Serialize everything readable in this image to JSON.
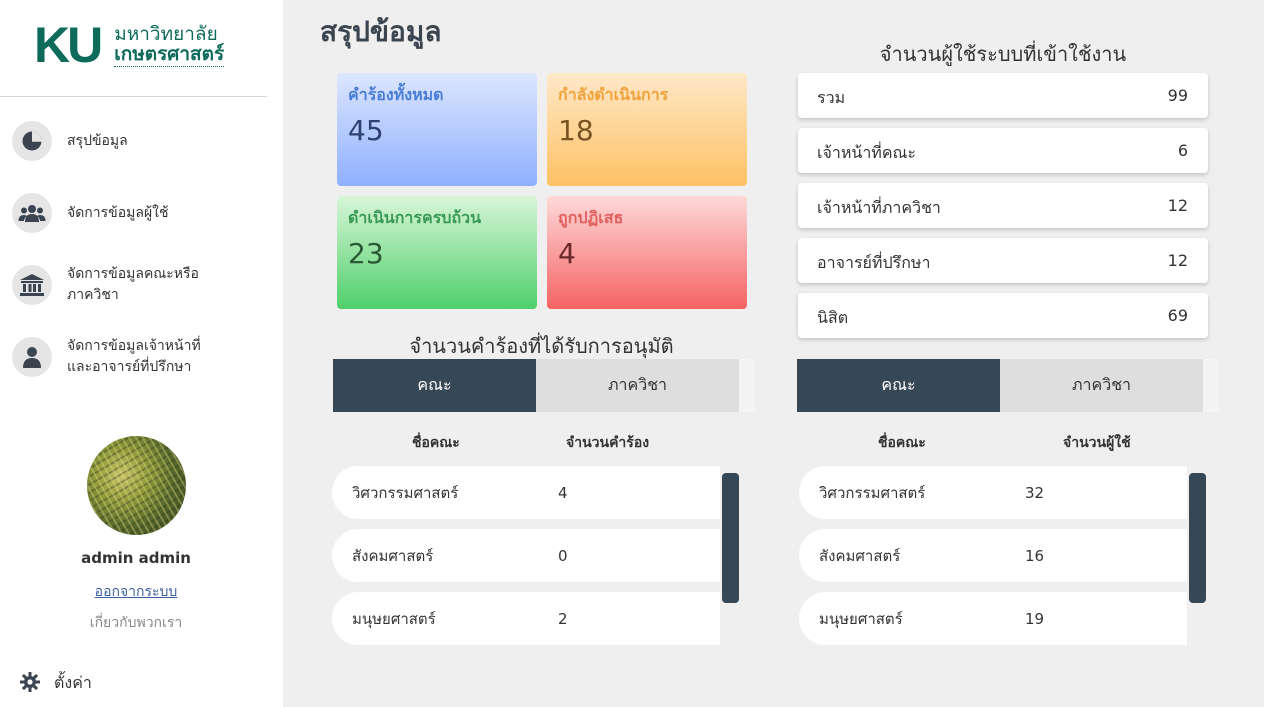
{
  "logo": {
    "mark": "KU",
    "line1": "มหาวิทยาลัย",
    "line2": "เกษตรศาสตร์"
  },
  "sidebar": {
    "items": [
      {
        "label": "สรุปข้อมูล",
        "icon": "pie-chart-icon"
      },
      {
        "label": "จัดการข้อมูลผู้ใช้",
        "icon": "users-icon"
      },
      {
        "label": "จัดการข้อมูลคณะหรือภาควิชา",
        "icon": "institution-icon"
      },
      {
        "label": "จัดการข้อมูลเจ้าหน้าที่และอาจารย์ที่ปรึกษา",
        "icon": "person-icon"
      }
    ],
    "username": "admin admin",
    "logout": "ออกจากระบบ",
    "about": "เกี่ยวกับพวกเรา",
    "settings": "ตั้งค่า"
  },
  "main": {
    "title": "สรุปข้อมูล",
    "cards": {
      "total": {
        "label": "คำร้องทั้งหมด",
        "value": "45"
      },
      "progress": {
        "label": "กำลังดำเนินการ",
        "value": "18"
      },
      "done": {
        "label": "ดำเนินการครบถ้วน",
        "value": "23"
      },
      "rejected": {
        "label": "ถูกปฏิเสธ",
        "value": "4"
      }
    },
    "approved": {
      "title": "จำนวนคำร้องที่ได้รับการอนุมัติ",
      "tabs": [
        "คณะ",
        "ภาควิชา"
      ],
      "col_name": "ชื่อคณะ",
      "col_value": "จำนวนคำร้อง",
      "rows": [
        {
          "name": "วิศวกรรมศาสตร์",
          "value": "4"
        },
        {
          "name": "สังคมศาสตร์",
          "value": "0"
        },
        {
          "name": "มนุษยศาสตร์",
          "value": "2"
        }
      ]
    },
    "users": {
      "title": "จำนวนผู้ใช้ระบบที่เข้าใช้งาน",
      "stats": [
        {
          "label": "รวม",
          "value": "99"
        },
        {
          "label": "เจ้าหน้าที่คณะ",
          "value": "6"
        },
        {
          "label": "เจ้าหน้าที่ภาควิชา",
          "value": "12"
        },
        {
          "label": "อาจารย์ที่ปรึกษา",
          "value": "12"
        },
        {
          "label": "นิสิต",
          "value": "69"
        }
      ],
      "tabs": [
        "คณะ",
        "ภาควิชา"
      ],
      "col_name": "ชื่อคณะ",
      "col_value": "จำนวนผู้ใช้",
      "rows": [
        {
          "name": "วิศวกรรมศาสตร์",
          "value": "32"
        },
        {
          "name": "สังคมศาสตร์",
          "value": "16"
        },
        {
          "name": "มนุษยศาสตร์",
          "value": "19"
        }
      ]
    }
  },
  "colors": {
    "brand": "#0e6b5c",
    "active_tab": "#364756"
  }
}
